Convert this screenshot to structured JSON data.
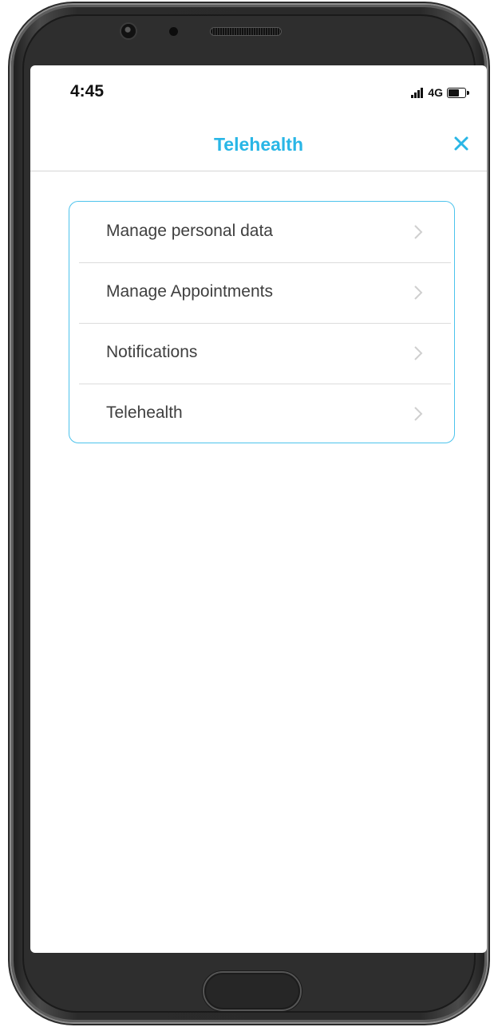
{
  "status_bar": {
    "time": "4:45",
    "network": "4G",
    "battery_level": 0.6
  },
  "header": {
    "title": "Telehealth",
    "close_icon": "close-icon",
    "accent_color": "#29b6e6"
  },
  "menu": {
    "items": [
      {
        "label": "Manage personal data",
        "icon": "chevron-right-icon"
      },
      {
        "label": "Manage Appointments",
        "icon": "chevron-right-icon"
      },
      {
        "label": "Notifications",
        "icon": "chevron-right-icon"
      },
      {
        "label": "Telehealth",
        "icon": "chevron-right-icon"
      }
    ],
    "border_color": "#4cc3ec"
  }
}
